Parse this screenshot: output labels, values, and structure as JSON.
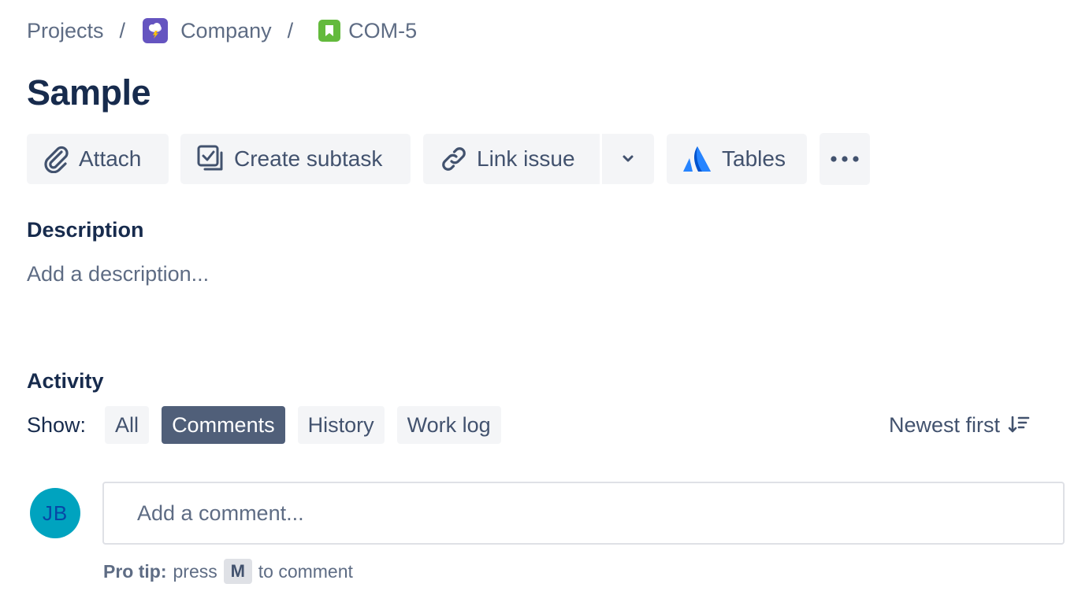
{
  "breadcrumb": {
    "projects": "Projects",
    "separator": "/",
    "project": "Company",
    "issue_key": "COM-5"
  },
  "issue": {
    "title": "Sample"
  },
  "toolbar": {
    "attach": "Attach",
    "create_subtask": "Create subtask",
    "link_issue": "Link issue",
    "tables": "Tables"
  },
  "description": {
    "heading": "Description",
    "placeholder": "Add a description..."
  },
  "activity": {
    "heading": "Activity",
    "show_label": "Show:",
    "filters": [
      "All",
      "Comments",
      "History",
      "Work log"
    ],
    "active_filter": "Comments",
    "sort": "Newest first"
  },
  "comment": {
    "avatar_initials": "JB",
    "placeholder": "Add a comment...",
    "pro_tip_label": "Pro tip:",
    "pro_tip_press": "press",
    "pro_tip_key": "M",
    "pro_tip_suffix": "to comment"
  },
  "colors": {
    "project_icon": "#6554c0",
    "issue_icon": "#63ba3c",
    "active_filter_bg": "#505f79",
    "avatar_bg": "#00a3bf",
    "tables_icon": "#2684ff"
  },
  "icons": {
    "project": "storm-cloud-icon",
    "issue_type": "story-bookmark-icon",
    "attach": "paperclip-icon",
    "subtask": "subtask-icon",
    "link": "link-icon",
    "dropdown": "chevron-down-icon",
    "tables": "atlassian-tables-icon",
    "more": "more-horizontal-icon",
    "sort": "sort-descending-icon"
  }
}
